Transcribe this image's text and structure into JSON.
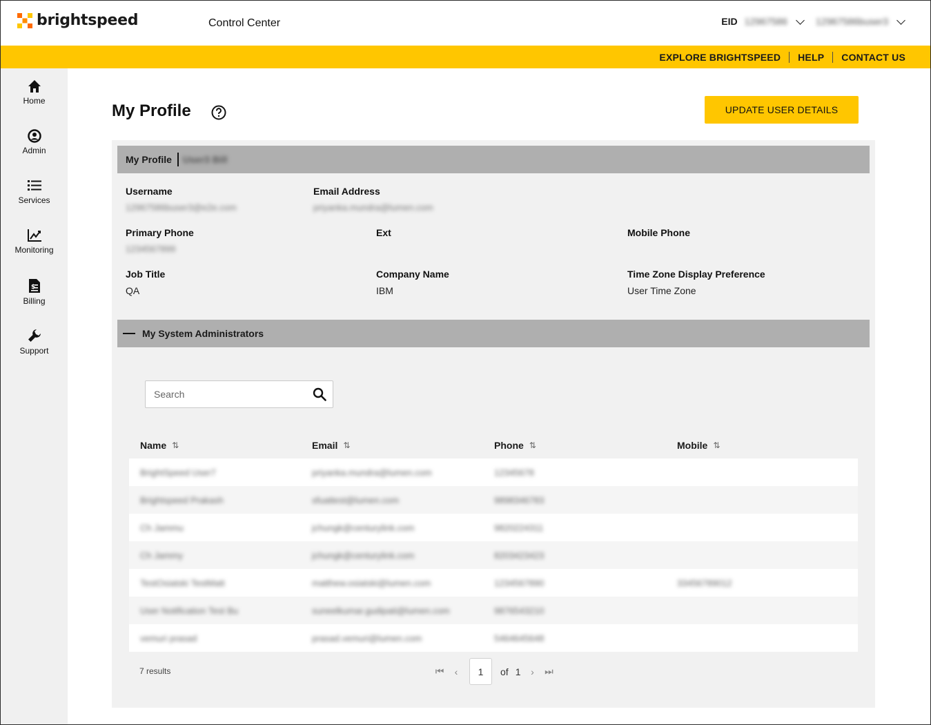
{
  "header": {
    "brand": "brightspeed",
    "app_title": "Control Center",
    "eid_label": "EID",
    "eid_value": "12967586",
    "user_value": "12967586buser3"
  },
  "topnav": {
    "explore": "EXPLORE BRIGHTSPEED",
    "help": "HELP",
    "contact": "CONTACT US"
  },
  "sidebar": {
    "items": [
      {
        "label": "Home",
        "icon": "home-icon"
      },
      {
        "label": "Admin",
        "icon": "user-circle-icon"
      },
      {
        "label": "Services",
        "icon": "list-icon"
      },
      {
        "label": "Monitoring",
        "icon": "chart-icon"
      },
      {
        "label": "Billing",
        "icon": "bill-icon"
      },
      {
        "label": "Support",
        "icon": "wrench-icon"
      }
    ]
  },
  "page": {
    "title": "My Profile",
    "update_button": "UPDATE USER DETAILS"
  },
  "profile": {
    "section_title": "My Profile",
    "section_user": "User3 Bill",
    "username_label": "Username",
    "username_value": "12967586buser3@e2e.com",
    "email_label": "Email Address",
    "email_value": "priyanka.mundra@lumen.com",
    "primary_phone_label": "Primary Phone",
    "primary_phone_value": "1234567899",
    "ext_label": "Ext",
    "mobile_label": "Mobile Phone",
    "job_title_label": "Job Title",
    "job_title_value": "QA",
    "company_label": "Company Name",
    "company_value": "IBM",
    "tz_label": "Time Zone Display Preference",
    "tz_value": "User Time Zone"
  },
  "admins": {
    "section_title": "My System Administrators",
    "search_placeholder": "Search",
    "columns": {
      "name": "Name",
      "email": "Email",
      "phone": "Phone",
      "mobile": "Mobile"
    },
    "rows": [
      {
        "name": "BrightSpeed User7",
        "email": "priyanka.mundra@lumen.com",
        "phone": "12345678",
        "mobile": ""
      },
      {
        "name": "Brightspeed Prakash",
        "email": "sfuattest@lumen.com",
        "phone": "9898346783",
        "mobile": ""
      },
      {
        "name": "Ch Jammu",
        "email": "jchungk@centurylink.com",
        "phone": "9820224311",
        "mobile": ""
      },
      {
        "name": "Ch Jammy",
        "email": "jchungk@centurylink.com",
        "phone": "8203423423",
        "mobile": ""
      },
      {
        "name": "TestOsiatski TestMatt",
        "email": "matthew.osiatski@lumen.com",
        "phone": "1234567890",
        "mobile": "33456789012"
      },
      {
        "name": "User Notification Test Bu",
        "email": "suneelkumar.gudipati@lumen.com",
        "phone": "9876543210",
        "mobile": ""
      },
      {
        "name": "vemuri prasad",
        "email": "prasad.vemuri@lumen.com",
        "phone": "5464645648",
        "mobile": ""
      }
    ],
    "results": "7 results",
    "page": "1",
    "of_label": "of",
    "total_pages": "1"
  },
  "colors": {
    "accent": "#ffc600",
    "section": "#afafaf",
    "sidebar": "#f0f0f0"
  }
}
